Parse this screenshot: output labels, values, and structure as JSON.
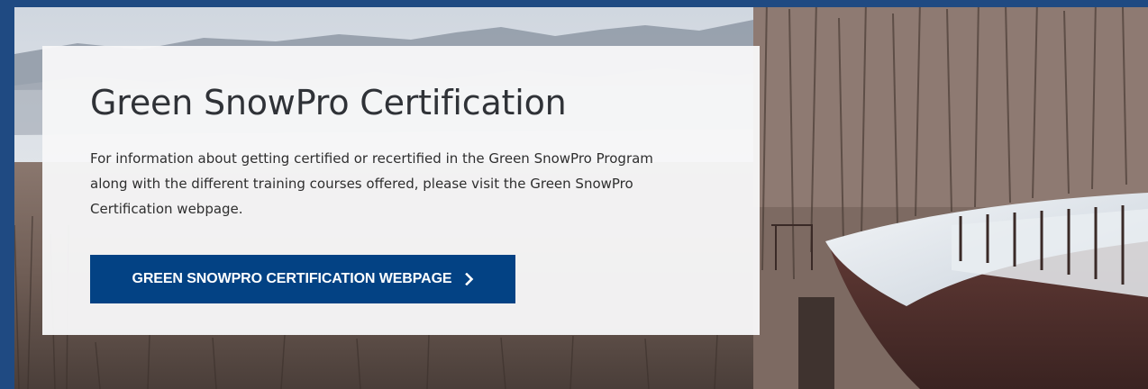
{
  "hero": {
    "title": "Green SnowPro Certification",
    "description": "For information about getting certified or recertified in the Green SnowPro Program along with the different training courses offered, please visit the Green SnowPro Certification webpage.",
    "cta_label": "GREEN SNOWPRO CERTIFICATION WEBPAGE",
    "cta_icon": "chevron-right-icon",
    "background_image": "snowy-forest-boardwalk-photo"
  },
  "colors": {
    "frame": "#1f4a82",
    "card": "#f7f7f8",
    "button": "#034284",
    "title": "#2f3237",
    "body_text": "#2e2e2e"
  }
}
